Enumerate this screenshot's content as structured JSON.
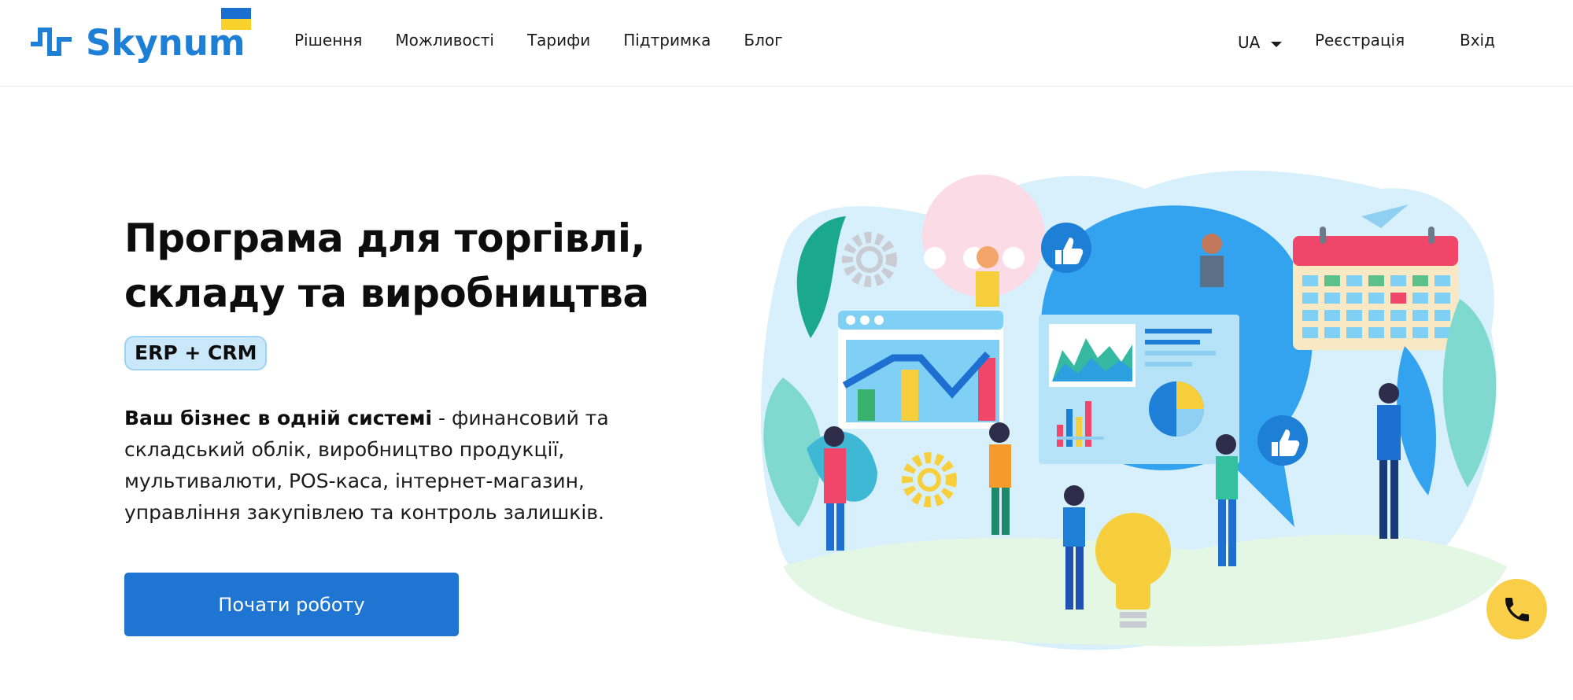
{
  "header": {
    "logo_text": "Skynum",
    "nav": [
      "Рішення",
      "Можливості",
      "Тарифи",
      "Підтримка",
      "Блог"
    ],
    "language": "UA",
    "register_label": "Реєстрація",
    "login_label": "Вхід"
  },
  "hero": {
    "title_line1": "Програма для торгівлі,",
    "title_line2": "складу та виробництва",
    "badge": "ERP + CRM",
    "description_bold": "Ваш бізнес в одній системі",
    "description_rest": " - финансовий та складський облік, виробництво продукції, мультивалюти, POS-каса, інтернет-магазин, управління закупівлею та контроль залишків.",
    "cta_label": "Почати роботу"
  },
  "colors": {
    "brand_blue": "#1e7fd6",
    "cta_blue": "#1e76d2",
    "badge_bg": "#cbe8fb",
    "phone_yellow": "#f9cf4a"
  },
  "icons": {
    "logo": "pulse-logo-icon",
    "flag": "ukraine-flag-icon",
    "language_caret": "caret-down-icon",
    "phone": "phone-icon"
  }
}
